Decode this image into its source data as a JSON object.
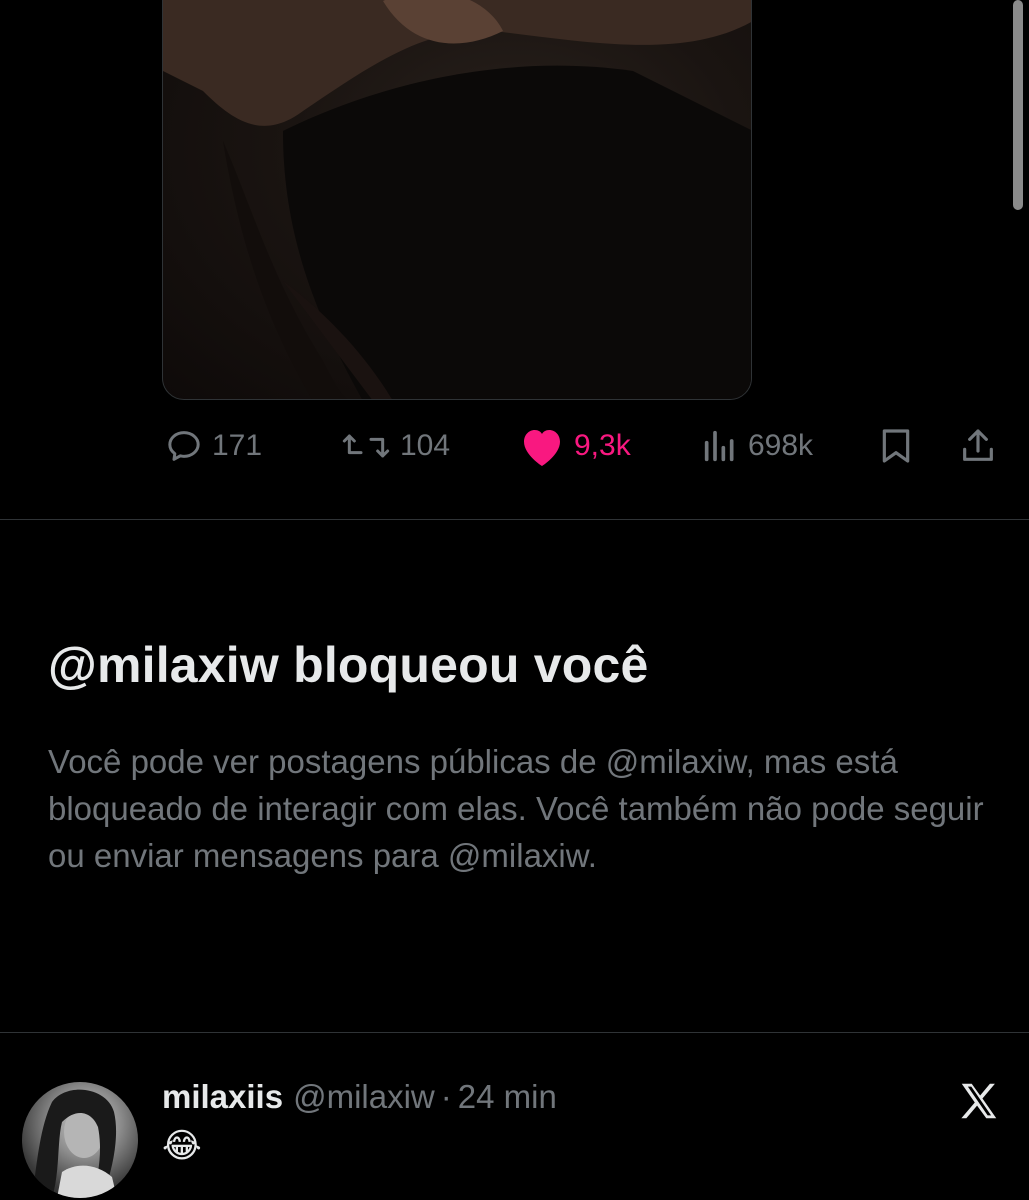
{
  "tweet": {
    "image_alt_icon": "photo",
    "actions": {
      "replies": "171",
      "retweets": "104",
      "likes": "9,3k",
      "views": "698k"
    },
    "colors": {
      "like": "#f91880",
      "muted": "#71767b",
      "text": "#e7e9ea",
      "background": "#000000"
    }
  },
  "block_notice": {
    "title": "@milaxiw bloqueou você",
    "description": "Você pode ver postagens públicas de @milaxiw, mas está bloqueado de interagir com elas. Você também não pode seguir ou enviar mensagens para @milaxiw."
  },
  "reply": {
    "display_name": "milaxiis",
    "handle": "@milaxiw",
    "separator": "·",
    "time": "24 min",
    "text": "😂"
  }
}
